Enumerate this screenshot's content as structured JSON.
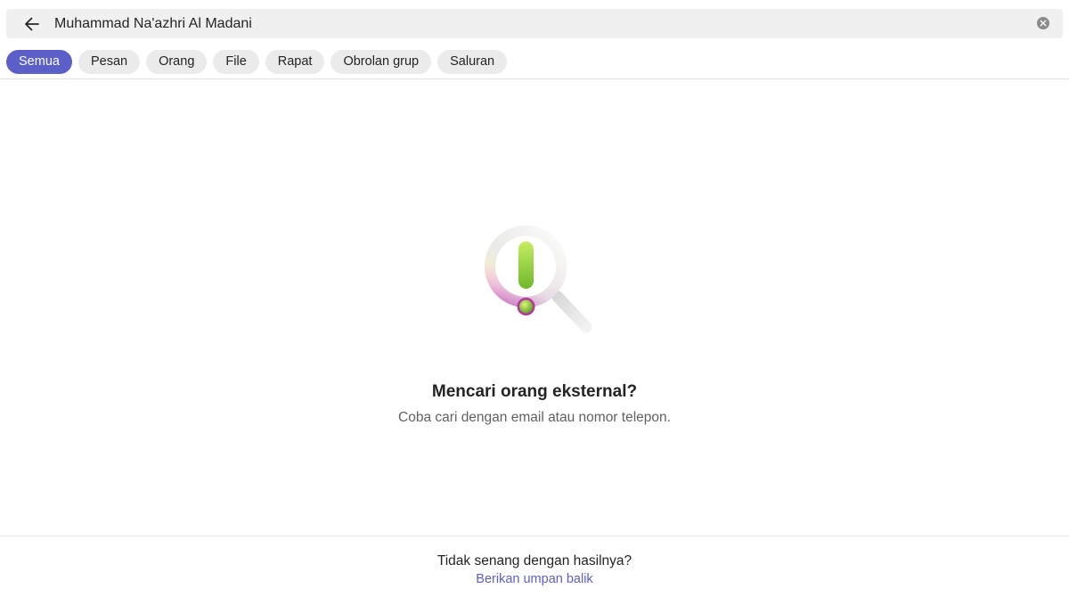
{
  "search": {
    "value": "Muhammad Na'azhri Al Madani",
    "back_icon": "arrow-left-icon",
    "clear_icon": "clear-circle-icon"
  },
  "filters": [
    {
      "label": "Semua",
      "active": true
    },
    {
      "label": "Pesan",
      "active": false
    },
    {
      "label": "Orang",
      "active": false
    },
    {
      "label": "File",
      "active": false
    },
    {
      "label": "Rapat",
      "active": false
    },
    {
      "label": "Obrolan grup",
      "active": false
    },
    {
      "label": "Saluran",
      "active": false
    }
  ],
  "empty_state": {
    "icon": "magnifier-exclamation-icon",
    "title": "Mencari orang eksternal?",
    "subtitle": "Coba cari dengan email atau nomor telepon."
  },
  "feedback": {
    "question": "Tidak senang dengan hasilnya?",
    "link": "Berikan umpan balik"
  },
  "colors": {
    "accent": "#5b5fc7",
    "pill_bg": "#ebebeb",
    "search_bg": "#f0f0f0"
  }
}
